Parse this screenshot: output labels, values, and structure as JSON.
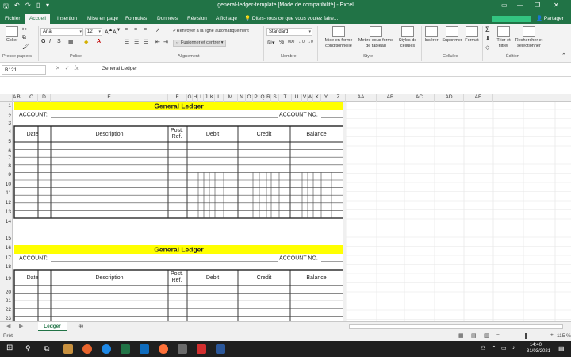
{
  "window": {
    "title": "general-ledger-template  [Mode de compatibilité] - Excel",
    "share_label": "Partager"
  },
  "tabs": [
    "Fichier",
    "Accueil",
    "Insertion",
    "Mise en page",
    "Formules",
    "Données",
    "Révision",
    "Affichage"
  ],
  "active_tab": "Accueil",
  "tell_me": "Dites-nous ce que vous voulez faire...",
  "ribbon": {
    "groups": [
      "Presse-papiers",
      "Police",
      "Alignement",
      "Nombre",
      "Style",
      "Cellules",
      "Édition"
    ],
    "paste_label": "Coller",
    "font_name": "Arial",
    "font_size": "12",
    "wrap_text_label": "Renvoyer à la ligne automatiquement",
    "merge_center_label": "Fusionner et centrer",
    "number_format": "Standard",
    "cond_format_label1": "Mise en forme",
    "cond_format_label2": "conditionnelle",
    "format_table_label1": "Mettre sous forme",
    "format_table_label2": "de tableau",
    "cell_styles_label1": "Styles de",
    "cell_styles_label2": "cellules",
    "insert_label": "Insérer",
    "delete_label": "Supprimer",
    "format_label": "Format",
    "sort_filter_label1": "Trier et",
    "sort_filter_label2": "filtrer",
    "find_select_label1": "Rechercher et",
    "find_select_label2": "sélectionner"
  },
  "formula_bar": {
    "name_box": "B121",
    "value": "General Ledger"
  },
  "columns": [
    "A",
    "B",
    "C",
    "D",
    "E",
    "F",
    "G",
    "H",
    "I",
    "J",
    "K",
    "L",
    "M",
    "N",
    "O",
    "P",
    "Q",
    "R",
    "S",
    "T",
    "U",
    "V",
    "W",
    "X",
    "Y",
    "Z",
    "AA",
    "AB",
    "AC",
    "AD",
    "AE"
  ],
  "rows": [
    "1",
    "2",
    "3",
    "4",
    "5",
    "6",
    "7",
    "8",
    "9",
    "10",
    "11",
    "12",
    "13",
    "14",
    "15",
    "16",
    "17",
    "18",
    "19",
    "20",
    "21",
    "22",
    "23",
    "24"
  ],
  "ledger": {
    "title": "General Ledger",
    "account_label": "ACCOUNT:",
    "account_no_label": "ACCOUNT NO.",
    "headers": [
      "Date",
      "Description",
      "Post.",
      "Ref.",
      "Debit",
      "Credit",
      "Balance"
    ]
  },
  "sheet_tab": "Ledger",
  "status": {
    "left": "Prêt",
    "zoom": "115 %"
  },
  "taskbar": {
    "time": "14:40",
    "date": "31/03/2021"
  },
  "colors": {
    "excel_green": "#217346",
    "ledger_title_fill": "#ffff00"
  }
}
